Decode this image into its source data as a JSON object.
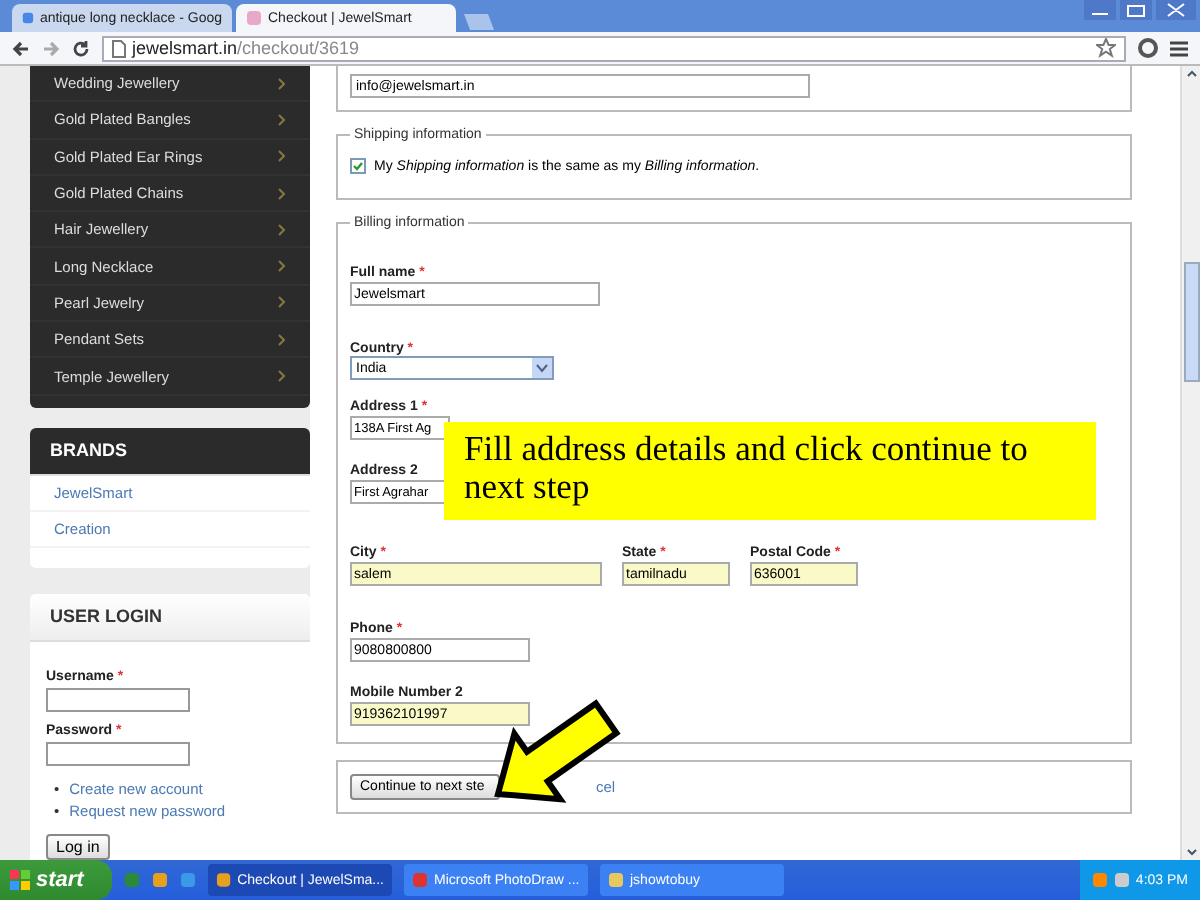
{
  "browser": {
    "tabs": [
      {
        "title": "antique long necklace - Goog",
        "selected": false
      },
      {
        "title": "Checkout | JewelSmart",
        "selected": true
      }
    ],
    "address": {
      "host": "jewelsmart.in",
      "path": "/checkout/3619"
    }
  },
  "sidebar": {
    "categories": [
      "Wedding Jewellery",
      "Gold Plated Bangles",
      "Gold Plated Ear Rings",
      "Gold Plated Chains",
      "Hair Jewellery",
      "Long Necklace",
      "Pearl Jewelry",
      "Pendant Sets",
      "Temple Jewellery"
    ],
    "brands": {
      "title": "BRANDS",
      "items": [
        "JewelSmart",
        "Creation"
      ]
    },
    "login": {
      "title": "USER LOGIN",
      "fields": [
        {
          "label": "Username",
          "required_mark": "*"
        },
        {
          "label": "Password",
          "required_mark": "*"
        }
      ],
      "links": [
        {
          "bullet": "•",
          "text": "Create new account"
        },
        {
          "bullet": "•",
          "text": "Request new password"
        }
      ],
      "button": "Log in"
    }
  },
  "email": {
    "value": "info@jewelsmart.in"
  },
  "shipping": {
    "legend": "Shipping information",
    "checked": true,
    "text": "My *Shipping information* is the same as my *Billing information*."
  },
  "billing": {
    "legend": "Billing information",
    "rows": [
      {
        "fields": [
          {
            "kind": "input",
            "label": "Full name",
            "required_mark": "*",
            "value": "Jewelsmart",
            "autofilled": false
          }
        ]
      },
      {
        "fields": [
          {
            "kind": "select",
            "label": "Country",
            "required_mark": "*",
            "value": "India"
          }
        ]
      },
      {
        "fields": [
          {
            "kind": "input",
            "label": "Address 1",
            "required_mark": "*",
            "value": "138A First Ag",
            "autofilled": false
          }
        ]
      },
      {
        "fields": [
          {
            "kind": "input",
            "label": "Address 2",
            "value": "First Agrahar",
            "autofilled": false
          }
        ]
      },
      {
        "fields": [
          {
            "kind": "input",
            "label": "City",
            "required_mark": "*",
            "value": "salem",
            "autofilled": true
          },
          {
            "kind": "input",
            "label": "State",
            "required_mark": "*",
            "value": "tamilnadu",
            "autofilled": true
          },
          {
            "kind": "input",
            "label": "Postal Code",
            "required_mark": "*",
            "value": "636001",
            "autofilled": true
          }
        ]
      },
      {
        "fields": [
          {
            "kind": "input",
            "label": "Phone",
            "required_mark": "*",
            "value": "9080800800",
            "autofilled": false
          }
        ]
      },
      {
        "fields": [
          {
            "kind": "input",
            "label": "Mobile Number 2",
            "value": "919362101997",
            "autofilled": true
          }
        ]
      }
    ]
  },
  "actions": {
    "continue": "Continue to next ste",
    "cancel": "cel"
  },
  "callout": "Fill address details and click continue to next step",
  "taskbar": {
    "start": "start",
    "tasks": [
      {
        "title": "Checkout | JewelSma...",
        "selected": true
      },
      {
        "title": "Microsoft PhotoDraw ...",
        "selected": false
      },
      {
        "title": "jshowtobuy",
        "selected": false
      }
    ],
    "time": "4:03 PM"
  }
}
